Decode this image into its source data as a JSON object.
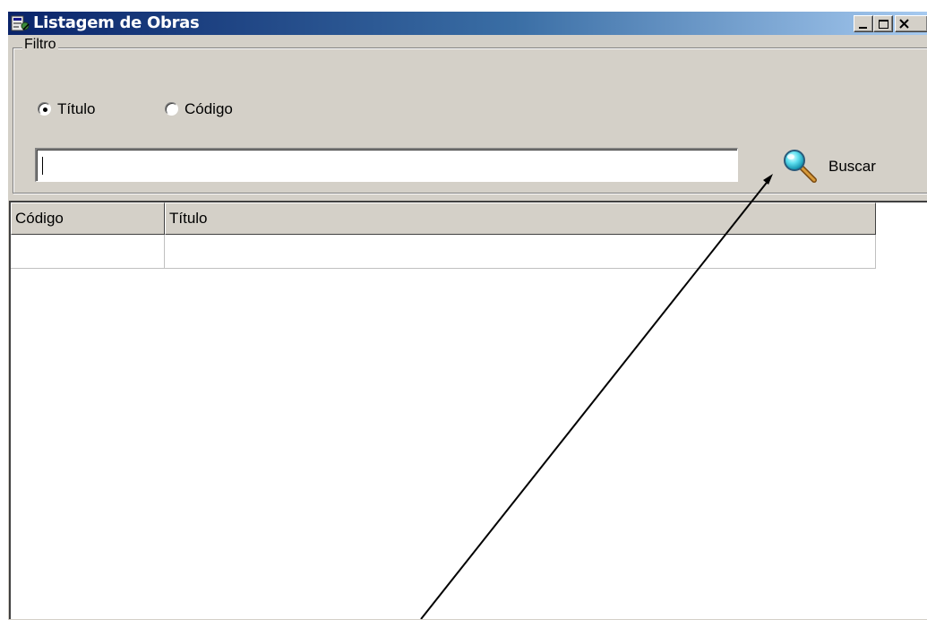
{
  "window": {
    "title": "Listagem de Obras",
    "title_icon": "app-icon",
    "controls": [
      "minimize-icon",
      "maximize-icon",
      "close-icon"
    ]
  },
  "filter": {
    "group_label": "Filtro",
    "options": [
      {
        "label": "Título",
        "selected": true
      },
      {
        "label": "Código",
        "selected": false
      }
    ],
    "search": {
      "value": "",
      "placeholder": ""
    },
    "search_button": {
      "label": "Buscar",
      "icon": "magnifier-icon"
    }
  },
  "grid": {
    "columns": [
      "Código",
      "Título"
    ],
    "rows": [
      [
        "",
        ""
      ]
    ]
  },
  "colors": {
    "titlebar_start": "#0a246a",
    "titlebar_end": "#a6caf0",
    "face": "#d4d0c8"
  }
}
